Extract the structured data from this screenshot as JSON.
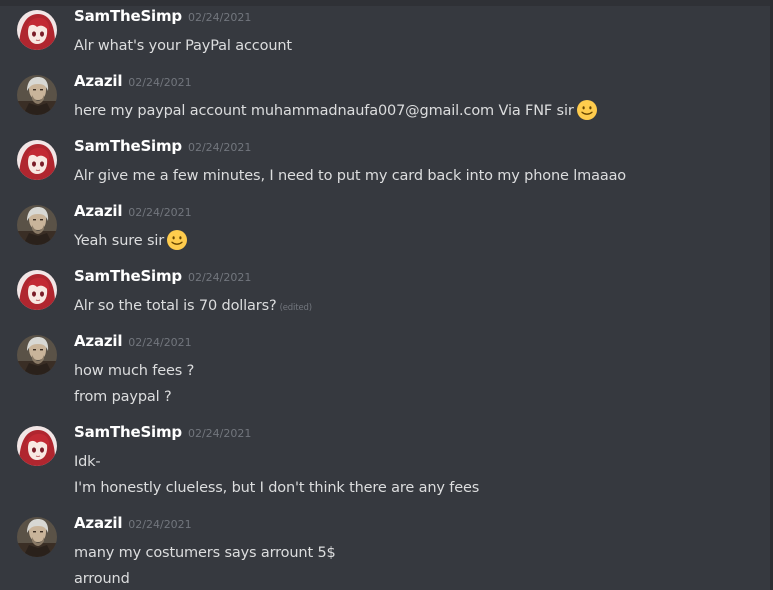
{
  "messages": [
    {
      "author": "SamTheSimp",
      "timestamp": "02/24/2021",
      "avatar": "red-hair-anime-avatar",
      "lines": [
        "Alr what's your PayPal account"
      ]
    },
    {
      "author": "Azazil",
      "timestamp": "02/24/2021",
      "avatar": "witcher-avatar",
      "lines": [
        "here my paypal account muhammadnaufa007@gmail.com Via FNF sir"
      ],
      "emoji": "slightly-smiling-face-icon"
    },
    {
      "author": "SamTheSimp",
      "timestamp": "02/24/2021",
      "avatar": "red-hair-anime-avatar",
      "lines": [
        "Alr give me a few minutes, I need to put my card back into my phone lmaaao"
      ]
    },
    {
      "author": "Azazil",
      "timestamp": "02/24/2021",
      "avatar": "witcher-avatar",
      "lines": [
        "Yeah sure sir"
      ],
      "emoji": "slightly-smiling-face-icon"
    },
    {
      "author": "SamTheSimp",
      "timestamp": "02/24/2021",
      "avatar": "red-hair-anime-avatar",
      "lines": [
        "Alr so the total is 70 dollars?"
      ],
      "edited": "(edited)"
    },
    {
      "author": "Azazil",
      "timestamp": "02/24/2021",
      "avatar": "witcher-avatar",
      "lines": [
        "how much fees ?",
        "from paypal ?"
      ]
    },
    {
      "author": "SamTheSimp",
      "timestamp": "02/24/2021",
      "avatar": "red-hair-anime-avatar",
      "lines": [
        "Idk-",
        "I'm honestly clueless, but I don't think there are any fees"
      ]
    },
    {
      "author": "Azazil",
      "timestamp": "02/24/2021",
      "avatar": "witcher-avatar",
      "lines": [
        "many my costumers says arrount 5$",
        "arround"
      ]
    }
  ]
}
